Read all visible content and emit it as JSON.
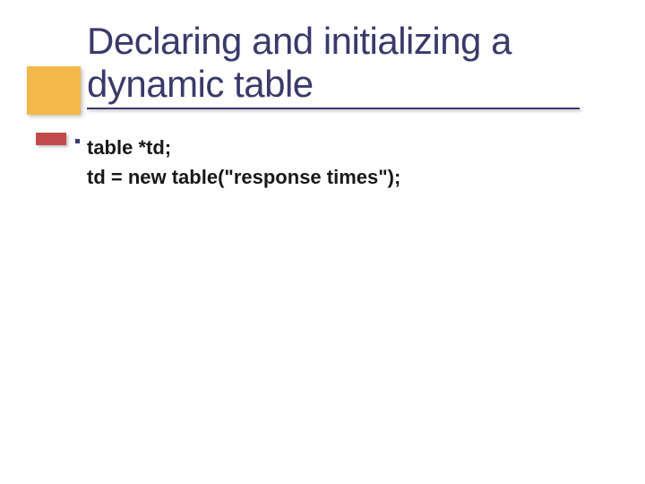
{
  "title": "Declaring and initializing a dynamic table",
  "code": {
    "line1": "table *td;",
    "line2": "td = new table(\"response times\");"
  }
}
